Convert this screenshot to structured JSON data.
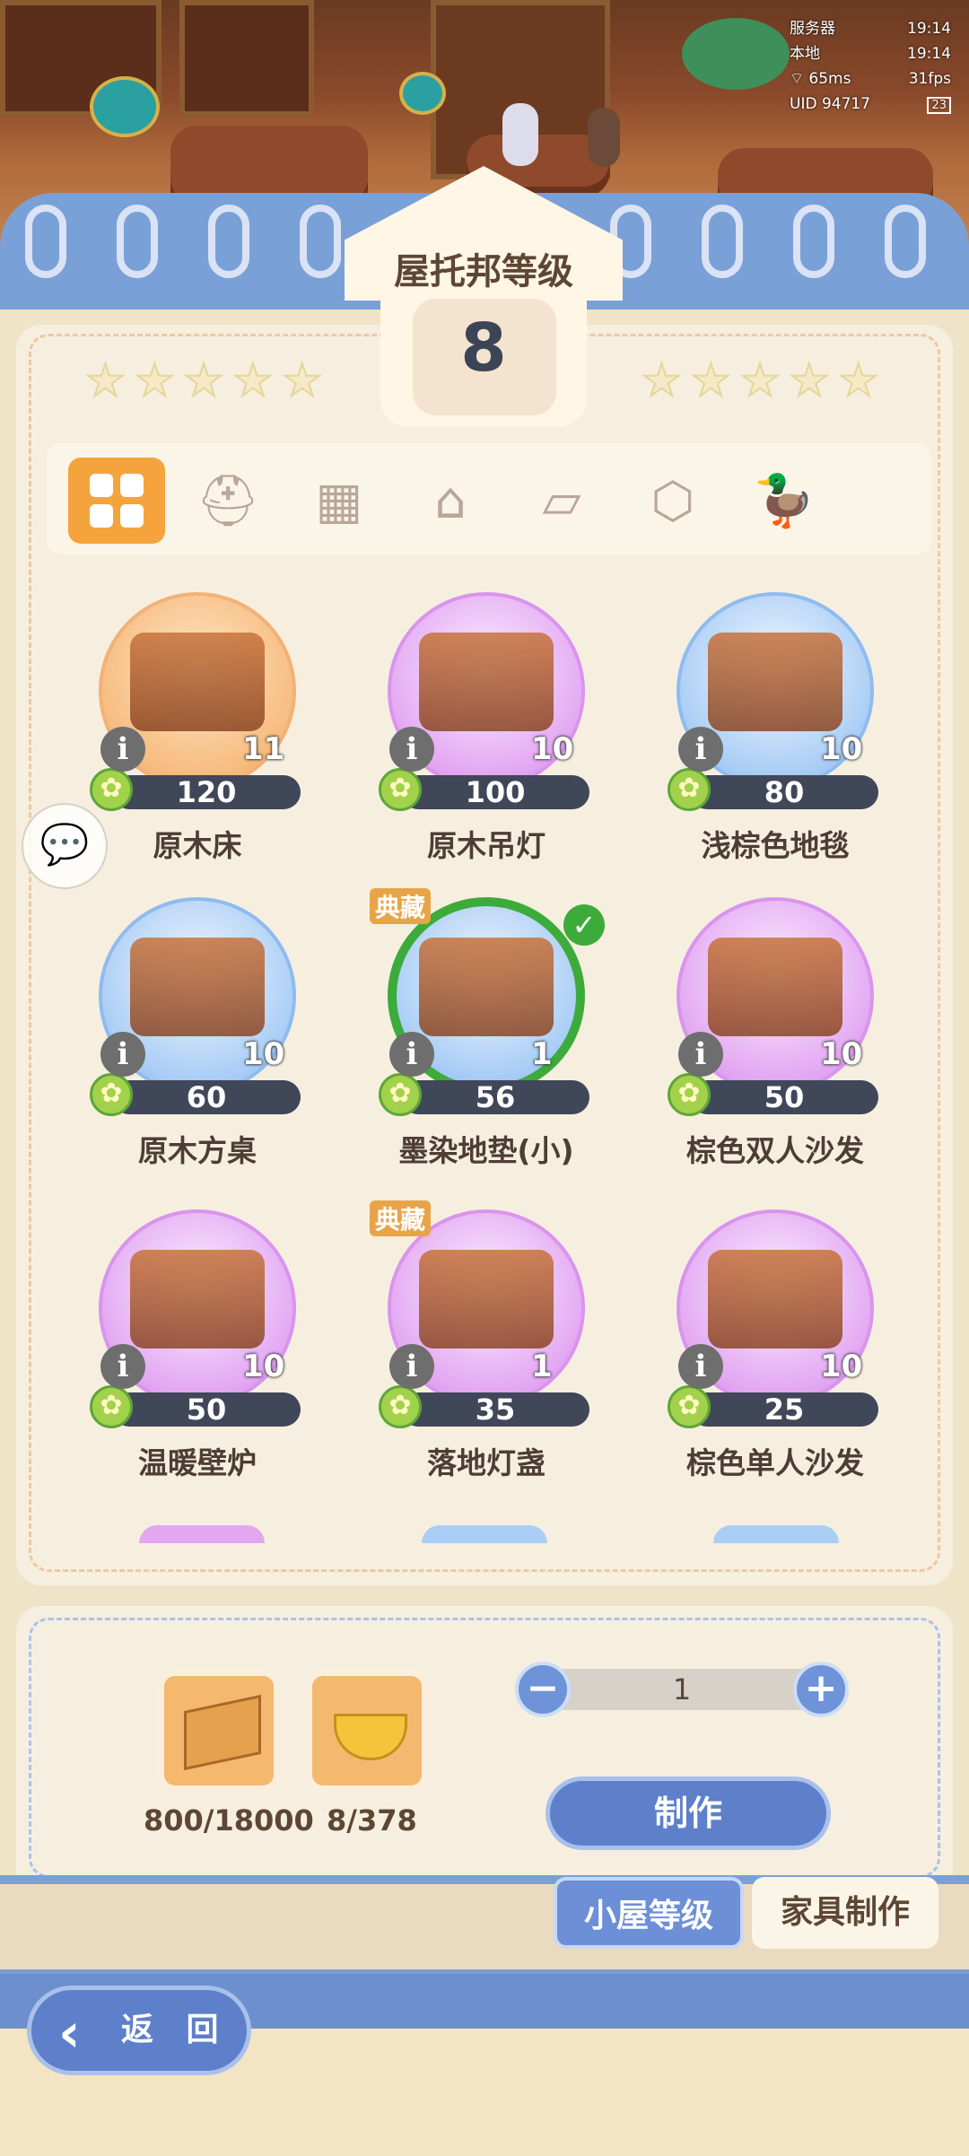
{
  "hud": {
    "server_label": "服务器",
    "server_time": "19:14",
    "local_label": "本地",
    "local_time": "19:14",
    "ping": "65ms",
    "fps": "31fps",
    "uid": "UID 94717",
    "battery": "23"
  },
  "house": {
    "title": "屋托邦等级",
    "level": "8"
  },
  "tabs": [
    {
      "icon": "all-grid-icon",
      "active": true
    },
    {
      "icon": "helmet-icon",
      "active": false
    },
    {
      "icon": "wall-brick-icon",
      "active": false
    },
    {
      "icon": "building-icon",
      "active": false
    },
    {
      "icon": "floor-tile-icon",
      "active": false
    },
    {
      "icon": "box-icon",
      "active": false
    },
    {
      "icon": "duck-icon",
      "active": false
    }
  ],
  "items": [
    {
      "name": "原木床",
      "price": "120",
      "count": "11",
      "bg": "orange"
    },
    {
      "name": "原木吊灯",
      "price": "100",
      "count": "10",
      "bg": "purple"
    },
    {
      "name": "浅棕色地毯",
      "price": "80",
      "count": "10",
      "bg": "blue"
    },
    {
      "name": "原木方桌",
      "price": "60",
      "count": "10",
      "bg": "blue"
    },
    {
      "name": "墨染地垫(小)",
      "price": "56",
      "count": "1",
      "bg": "blue",
      "tag": "典藏",
      "selected": true
    },
    {
      "name": "棕色双人沙发",
      "price": "50",
      "count": "10",
      "bg": "purple"
    },
    {
      "name": "温暖壁炉",
      "price": "50",
      "count": "10",
      "bg": "purple"
    },
    {
      "name": "落地灯盏",
      "price": "35",
      "count": "1",
      "bg": "purple",
      "tag": "典藏"
    },
    {
      "name": "棕色单人沙发",
      "price": "25",
      "count": "10",
      "bg": "purple"
    }
  ],
  "craft": {
    "materials": [
      {
        "icon": "wood-planks-icon",
        "amount": "800/18000"
      },
      {
        "icon": "golden-bowl-icon",
        "amount": "8/378"
      }
    ],
    "quantity": "1",
    "minus": "−",
    "plus": "+",
    "make_label": "制作"
  },
  "bottom_tabs": {
    "house_level": "小屋等级",
    "furniture_craft": "家具制作"
  },
  "back_label": "返 回"
}
